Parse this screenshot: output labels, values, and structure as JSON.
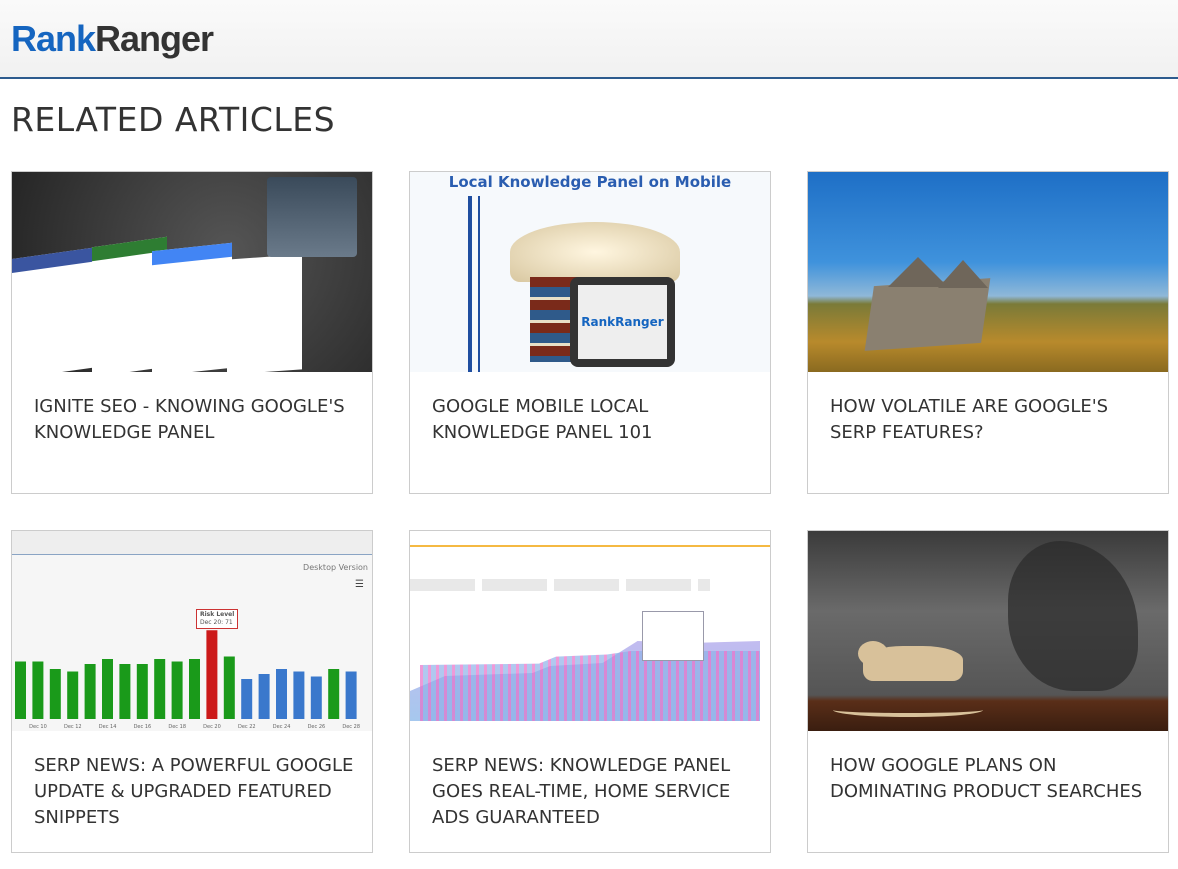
{
  "header": {
    "logo_part1": "Rank",
    "logo_part2": "Ranger"
  },
  "page_title": "RELATED ARTICLES",
  "articles": [
    {
      "title": "IGNITE SEO - KNOWING GOOGLE'S KNOWLEDGE PANEL"
    },
    {
      "title": "GOOGLE MOBILE LOCAL KNOWLEDGE PANEL 101",
      "image_caption": "Local Knowledge Panel on Mobile",
      "image_logo": "RankRanger"
    },
    {
      "title": "HOW VOLATILE ARE GOOGLE'S SERP FEATURES?"
    },
    {
      "title": "SERP NEWS: A POWERFUL GOOGLE UPDATE & UPGRADED FEATURED SNIPPETS",
      "image_label": "Desktop Version",
      "tooltip_title": "Risk Level",
      "tooltip_value": "Dec 20: 71",
      "chart_ticks": [
        "Dec 10",
        "Dec 12",
        "Dec 14",
        "Dec 16",
        "Dec 18",
        "Dec 20",
        "Dec 22",
        "Dec 24",
        "Dec 26",
        "Dec 28"
      ],
      "chart_values": [
        46,
        46,
        40,
        38,
        44,
        48,
        44,
        44,
        48,
        46,
        48,
        71,
        50,
        32,
        36,
        40,
        38,
        34,
        40,
        38
      ],
      "chart_colors": [
        "g",
        "g",
        "g",
        "g",
        "g",
        "g",
        "g",
        "g",
        "g",
        "g",
        "g",
        "r",
        "g",
        "b",
        "b",
        "b",
        "b",
        "b",
        "g",
        "b"
      ]
    },
    {
      "title": "SERP NEWS: KNOWLEDGE PANEL GOES REAL-TIME, HOME SERVICE ADS GUARANTEED"
    },
    {
      "title": "HOW GOOGLE PLANS ON DOMINATING PRODUCT SEARCHES"
    }
  ],
  "colors": {
    "brand_blue": "#1565c0",
    "header_rule": "#2d5b8e",
    "text": "#333333"
  }
}
